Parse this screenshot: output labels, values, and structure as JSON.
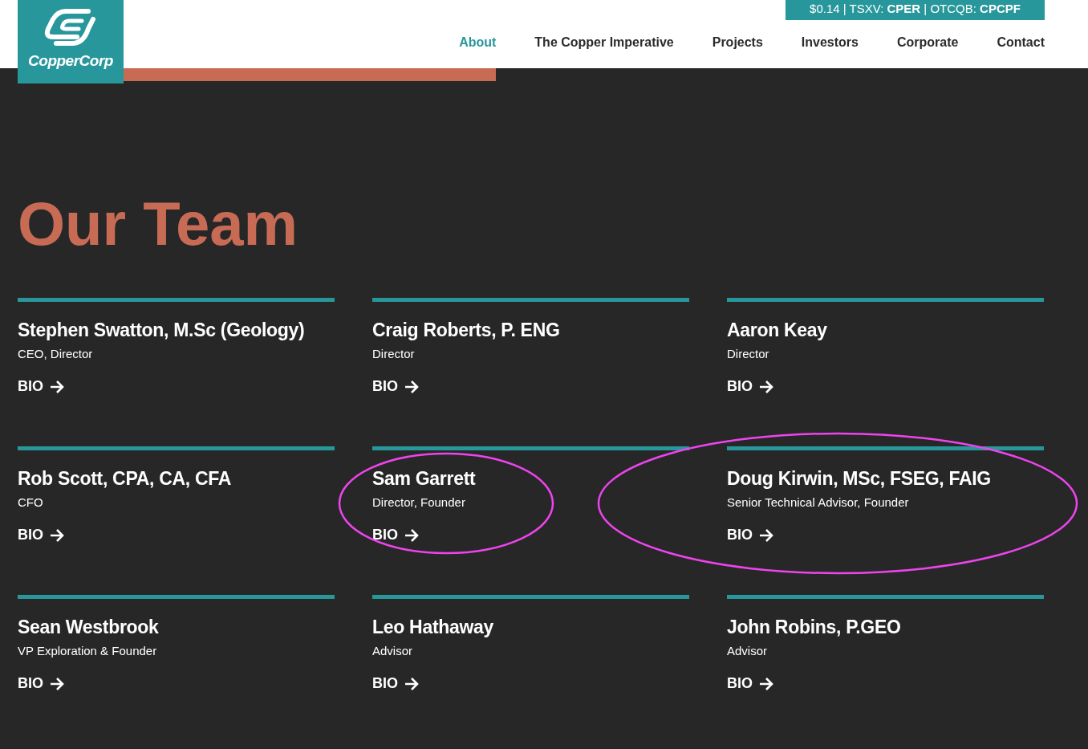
{
  "logo": {
    "text": "CopperCorp"
  },
  "ticker": "$0.14 | TSXV: **CPER** | OTCQB: **CPCPF**",
  "nav": [
    {
      "label": "About",
      "selected": true
    },
    {
      "label": "The Copper Imperative",
      "selected": false
    },
    {
      "label": "Projects",
      "selected": false
    },
    {
      "label": "Investors",
      "selected": false
    },
    {
      "label": "Corporate",
      "selected": false
    },
    {
      "label": "Contact",
      "selected": false
    }
  ],
  "heading": "Our Team",
  "team": [
    {
      "name": "Stephen Swatton, M.Sc (Geology)",
      "role": "CEO, Director",
      "link": "BIO"
    },
    {
      "name": "Craig Roberts, P. ENG",
      "role": "Director",
      "link": "BIO"
    },
    {
      "name": "Aaron Keay",
      "role": "Director",
      "link": "BIO"
    },
    {
      "name": "Rob Scott, CPA, CA, CFA",
      "role": "CFO",
      "link": "BIO"
    },
    {
      "name": "Sam Garrett",
      "role": "Director, Founder",
      "link": "BIO"
    },
    {
      "name": "Doug Kirwin, MSc, FSEG, FAIG",
      "role": "Senior Technical Advisor, Founder",
      "link": "BIO"
    },
    {
      "name": "Sean Westbrook",
      "role": "VP Exploration & Founder",
      "link": "BIO"
    },
    {
      "name": "Leo Hathaway",
      "role": "Advisor",
      "link": "BIO"
    },
    {
      "name": "John Robins, P.GEO",
      "role": "Advisor",
      "link": "BIO"
    }
  ]
}
